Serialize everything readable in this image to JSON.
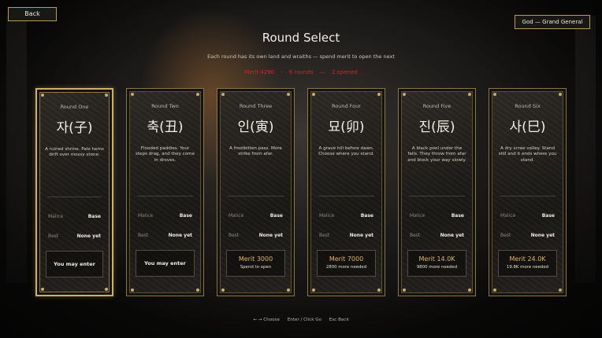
{
  "header": {
    "back_label": "Back",
    "rank_label": "God — Grand General",
    "title": "Round Select",
    "subtitle": "Each round has its own land and wraiths — spend merit to open the next",
    "status": {
      "merit": "Merit 4290",
      "sep1": "·",
      "rounds": "6 rounds",
      "sep2": "—",
      "opened": "2 opened"
    }
  },
  "rounds": [
    {
      "label": "Round One",
      "name": "자(子)",
      "desc": "A ruined shrine. Pale hems drift over mossy stone.",
      "malice_label": "Malice",
      "malice": "Base",
      "best_label": "Best",
      "best": "None yet",
      "action": "You may enter",
      "action_sub": "",
      "locked": false,
      "selected": true
    },
    {
      "label": "Round Two",
      "name": "축(丑)",
      "desc": "Flooded paddies. Your steps drag, and they come in droves.",
      "malice_label": "Malice",
      "malice": "Base",
      "best_label": "Best",
      "best": "None yet",
      "action": "You may enter",
      "action_sub": "",
      "locked": false,
      "selected": false
    },
    {
      "label": "Round Three",
      "name": "인(寅)",
      "desc": "A frostbitten pass. More strike from afar.",
      "malice_label": "Malice",
      "malice": "Base",
      "best_label": "Best",
      "best": "None yet",
      "action": "Merit 3000",
      "action_sub": "Spend to open",
      "locked": true,
      "selected": false
    },
    {
      "label": "Round Four",
      "name": "묘(卯)",
      "desc": "A grave hill before dawn. Choose where you stand.",
      "malice_label": "Malice",
      "malice": "Base",
      "best_label": "Best",
      "best": "None yet",
      "action": "Merit 7000",
      "action_sub": "2800 more needed",
      "locked": true,
      "selected": false
    },
    {
      "label": "Round Five",
      "name": "진(辰)",
      "desc": "A black pool under the falls. They throw from afar and block your way slowly.",
      "malice_label": "Malice",
      "malice": "Base",
      "best_label": "Best",
      "best": "None yet",
      "action": "Merit 14.0K",
      "action_sub": "9800 more needed",
      "locked": true,
      "selected": false
    },
    {
      "label": "Round Six",
      "name": "사(巳)",
      "desc": "A dry scree valley. Stand still and it ends where you stand.",
      "malice_label": "Malice",
      "malice": "Base",
      "best_label": "Best",
      "best": "None yet",
      "action": "Merit 24.0K",
      "action_sub": "19.8K more needed",
      "locked": true,
      "selected": false
    }
  ],
  "footer": {
    "choose": "← → Choose",
    "go": "Enter / Click Go",
    "back": "Esc Back"
  },
  "colors": {
    "accent_gold": "#cdb06b",
    "status_red": "#d8232a",
    "merit_gold": "#e1b65b"
  }
}
